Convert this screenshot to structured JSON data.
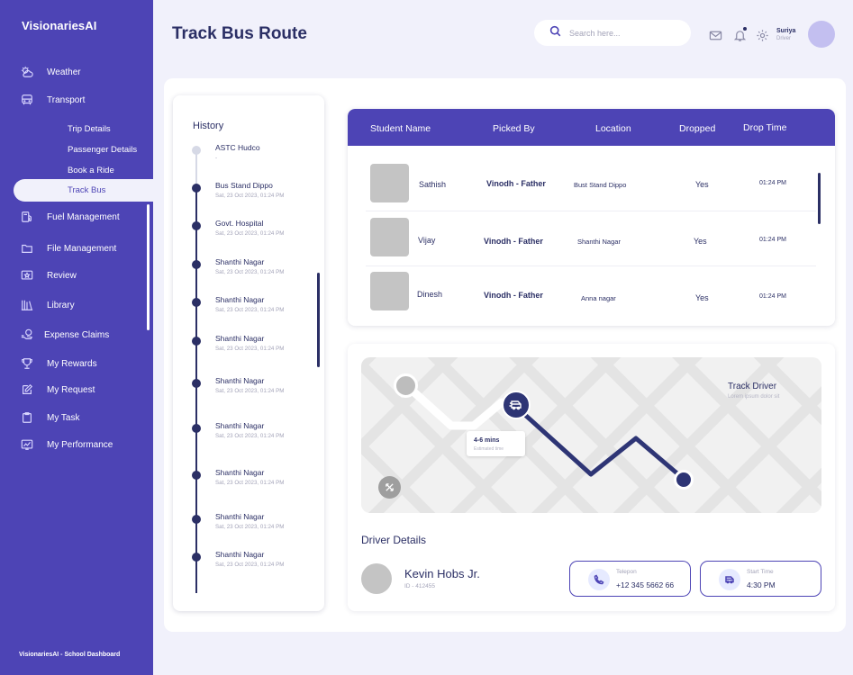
{
  "brand": "VisionariesAI",
  "sidebar": {
    "items": [
      {
        "label": "Weather",
        "icon": "weather-icon"
      },
      {
        "label": "Transport",
        "icon": "bus-icon"
      },
      {
        "label": "Fuel Management",
        "icon": "fuel-icon"
      },
      {
        "label": "File Management",
        "icon": "folder-icon"
      },
      {
        "label": "Review",
        "icon": "star-icon"
      },
      {
        "label": "Library",
        "icon": "library-icon"
      },
      {
        "label": "Expense Claims",
        "icon": "money-icon"
      },
      {
        "label": "My Rewards",
        "icon": "trophy-icon"
      },
      {
        "label": "My Request",
        "icon": "edit-icon"
      },
      {
        "label": "My Task",
        "icon": "clipboard-icon"
      },
      {
        "label": "My Performance",
        "icon": "chart-icon"
      }
    ],
    "subitems": [
      "Trip Details",
      "Passenger Details",
      "Book a Ride",
      "Track Bus"
    ],
    "active_subitem": "Track Bus",
    "footer": "VisionariesAI - School Dashboard"
  },
  "header": {
    "title": "Track Bus Route",
    "search_placeholder": "Search here...",
    "user_name": "Suriya",
    "user_role": "Driver"
  },
  "history": {
    "title": "History",
    "items": [
      {
        "place": "ASTC Hudco",
        "date": "-"
      },
      {
        "place": "Bus Stand Dippo",
        "date": "Sat, 23 Oct 2023, 01:24 PM"
      },
      {
        "place": "Govt. Hospital",
        "date": "Sat, 23 Oct 2023, 01:24 PM"
      },
      {
        "place": "Shanthi Nagar",
        "date": "Sat, 23 Oct 2023, 01:24 PM"
      },
      {
        "place": "Shanthi Nagar",
        "date": "Sat, 23 Oct 2023, 01:24 PM"
      },
      {
        "place": "Shanthi Nagar",
        "date": "Sat, 23 Oct 2023, 01:24 PM"
      },
      {
        "place": "Shanthi Nagar",
        "date": "Sat, 23 Oct 2023, 01:24 PM"
      },
      {
        "place": "Shanthi Nagar",
        "date": "Sat, 23 Oct 2023, 01:24 PM"
      },
      {
        "place": "Shanthi Nagar",
        "date": "Sat, 23 Oct 2023, 01:24 PM"
      },
      {
        "place": "Shanthi Nagar",
        "date": "Sat, 23 Oct 2023, 01:24 PM"
      },
      {
        "place": "Shanthi Nagar",
        "date": "Sat, 23 Oct 2023, 01:24 PM"
      }
    ]
  },
  "table": {
    "headers": [
      "Student Name",
      "Picked By",
      "Location",
      "Dropped",
      "Drop Time"
    ],
    "rows": [
      {
        "name": "Sathish",
        "picked_by": "Vinodh - Father",
        "location": "Bust Stand Dippo",
        "dropped": "Yes",
        "time": "01:24 PM"
      },
      {
        "name": "Vijay",
        "picked_by": "Vinodh - Father",
        "location": "Shanthi Nagar",
        "dropped": "Yes",
        "time": "01:24 PM"
      },
      {
        "name": "Dinesh",
        "picked_by": "Vinodh - Father",
        "location": "Anna nagar",
        "dropped": "Yes",
        "time": "01:24 PM"
      }
    ]
  },
  "map": {
    "title": "Track Driver",
    "subtitle": "Lorem ipsum dolor sit",
    "eta": "4-6 mins",
    "eta_label": "Estimated time"
  },
  "driver": {
    "section_title": "Driver Details",
    "name": "Kevin Hobs Jr.",
    "id": "ID - 412455",
    "phone_label": "Telepon",
    "phone": "+12 345 5662 66",
    "start_label": "Start Time",
    "start_time": "4:30 PM"
  },
  "colors": {
    "primary": "#4d44b5",
    "navy": "#2b2f65",
    "background": "#f1f1fb"
  }
}
